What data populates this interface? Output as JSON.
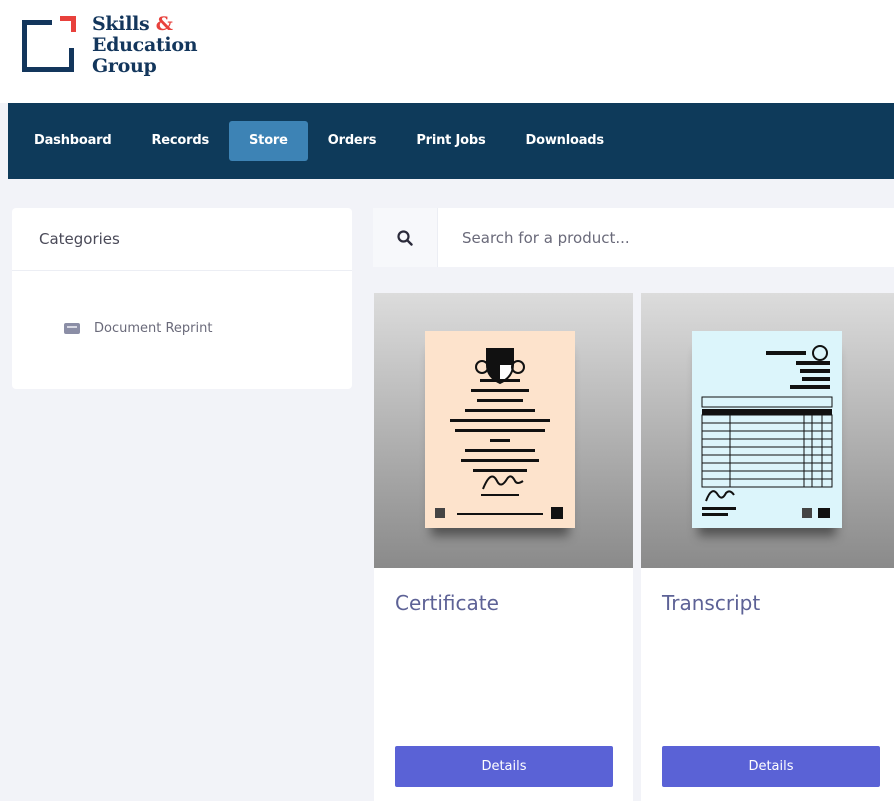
{
  "brand": {
    "line1": "Skills",
    "amp": "&",
    "line2": "Education",
    "line3": "Group",
    "colors": {
      "navy": "#13365c",
      "red": "#e8413c"
    }
  },
  "nav": {
    "items": [
      {
        "label": "Dashboard",
        "active": false
      },
      {
        "label": "Records",
        "active": false
      },
      {
        "label": "Store",
        "active": true
      },
      {
        "label": "Orders",
        "active": false
      },
      {
        "label": "Print Jobs",
        "active": false
      },
      {
        "label": "Downloads",
        "active": false
      }
    ],
    "colors": {
      "bar": "#0e3a5a",
      "active": "#3d83b5"
    }
  },
  "categories": {
    "title": "Categories",
    "items": [
      {
        "label": "Document Reprint",
        "icon": "document-icon"
      }
    ]
  },
  "search": {
    "placeholder": "Search for a product...",
    "icon": "search-icon"
  },
  "products": [
    {
      "title": "Certificate",
      "button": "Details",
      "image": "certificate-illustration",
      "paper_color": "#fde3cc"
    },
    {
      "title": "Transcript",
      "button": "Details",
      "image": "transcript-illustration",
      "paper_color": "#dcf5fb"
    }
  ],
  "colors": {
    "button": "#5a62d6",
    "title": "#5d6296",
    "page_bg": "#f2f3f8"
  }
}
